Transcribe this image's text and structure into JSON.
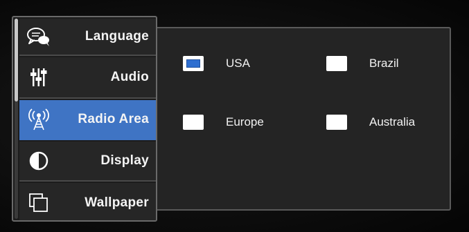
{
  "menu": {
    "items": [
      {
        "label": "Language",
        "icon": "speech-bubbles-icon",
        "active": false
      },
      {
        "label": "Audio",
        "icon": "equalizer-sliders-icon",
        "active": false
      },
      {
        "label": "Radio Area",
        "icon": "radio-antenna-icon",
        "active": true
      },
      {
        "label": "Display",
        "icon": "contrast-circle-icon",
        "active": false
      },
      {
        "label": "Wallpaper",
        "icon": "stacked-squares-icon",
        "active": false
      }
    ]
  },
  "radio_area": {
    "options": [
      {
        "label": "USA",
        "checked": true
      },
      {
        "label": "Brazil",
        "checked": false
      },
      {
        "label": "Europe",
        "checked": false
      },
      {
        "label": "Australia",
        "checked": false
      }
    ]
  },
  "colors": {
    "accent": "#3f74c4",
    "panel_bg": "#242424",
    "checkbox_fill": "#ffffff",
    "check_mark": "#2f6fd0"
  }
}
